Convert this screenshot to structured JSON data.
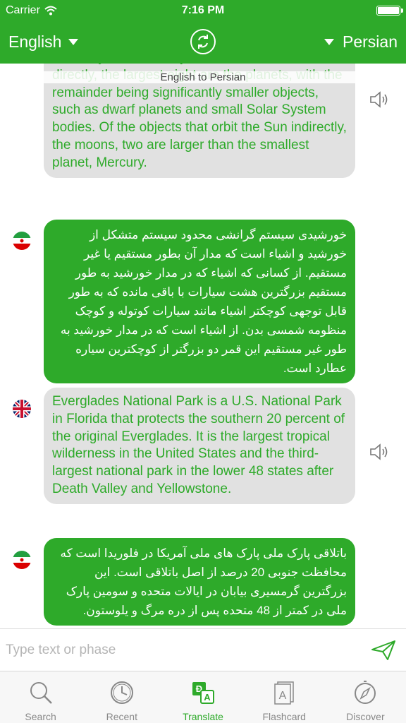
{
  "status_bar": {
    "carrier": "Carrier",
    "time": "7:16 PM",
    "battery_level": 1.0
  },
  "header": {
    "source_language": "English",
    "target_language": "Persian"
  },
  "chat": {
    "section_label": "English to Persian",
    "messages": [
      {
        "lang": "en",
        "text": "indirectly. Of those objects that orbit the Sun directly, the largest eight are the planets, with the remainder being significantly smaller objects, such as dwarf planets and small Solar System bodies. Of the objects that orbit the Sun indirectly, the moons, two are larger than the smallest planet, Mercury."
      },
      {
        "lang": "fa",
        "text": "خورشیدی سیستم گرانشی محدود سیستم متشکل از خورشید و اشیاء است که مدار آن بطور مستقیم یا غیر مستقیم. از کسانی که اشیاء که در مدار خورشید به طور مستقیم بزرگترین هشت سیارات با باقی مانده که به طور قابل توجهی کوچکتر اشیاء مانند سیارات کوتوله و کوچک منظومه شمسی بدن. از اشیاء است که در مدار خورشید به طور غیر مستقیم این قمر دو بزرگتر از کوچکترین سیاره عطارد است."
      },
      {
        "lang": "en",
        "text": "Everglades National Park is a U.S. National Park in Florida that protects the southern 20 percent of the original Everglades. It is the largest tropical wilderness in the United States and the third-largest national park in the lower 48 states after Death Valley and Yellowstone."
      },
      {
        "lang": "fa",
        "text": "باتلاقی پارک ملی پارک های ملی آمریکا در فلوریدا است که محافظت جنوبی 20 درصد از اصل باتلاقی است. این بزرگترین گرمسیری بیابان در ایالات متحده و سومین پارک ملی در کمتر از 48 متحده پس از دره مرگ و یلوستون."
      }
    ]
  },
  "input": {
    "placeholder": "Type text or phase"
  },
  "tabs": [
    {
      "label": "Search",
      "icon": "search-icon"
    },
    {
      "label": "Recent",
      "icon": "clock-icon"
    },
    {
      "label": "Translate",
      "icon": "translate-icon",
      "active": true
    },
    {
      "label": "Flashcard",
      "icon": "flashcard-icon"
    },
    {
      "label": "Discover",
      "icon": "compass-icon"
    }
  ],
  "colors": {
    "accent": "#2eaa2a",
    "bubble_source": "#e1e1e1",
    "tab_inactive": "#888888"
  }
}
